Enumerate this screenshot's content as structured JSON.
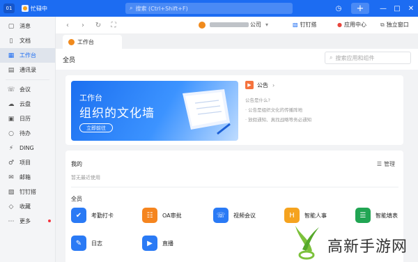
{
  "titlebar": {
    "user_id": "01",
    "status_text": "忙碌中",
    "search_placeholder": "搜索 (Ctrl+Shift+F)",
    "plus_label": "+"
  },
  "sidebar": {
    "items": [
      {
        "label": "消息",
        "icon": "message-icon"
      },
      {
        "label": "文档",
        "icon": "document-icon"
      },
      {
        "label": "工作台",
        "icon": "workbench-icon",
        "active": true
      },
      {
        "label": "通讯录",
        "icon": "contacts-icon"
      },
      {
        "label": "会议",
        "icon": "meeting-icon"
      },
      {
        "label": "云盘",
        "icon": "cloud-icon"
      },
      {
        "label": "日历",
        "icon": "calendar-icon"
      },
      {
        "label": "待办",
        "icon": "todo-icon"
      },
      {
        "label": "DING",
        "icon": "ding-icon"
      },
      {
        "label": "项目",
        "icon": "project-icon"
      },
      {
        "label": "邮箱",
        "icon": "mail-icon"
      },
      {
        "label": "钉钉搭",
        "icon": "dingda-icon"
      },
      {
        "label": "收藏",
        "icon": "favorite-icon"
      },
      {
        "label": "更多",
        "icon": "more-icon"
      }
    ]
  },
  "toolbar": {
    "org_suffix": "公司",
    "dingda_label": "钉钉搭",
    "app_center_label": "应用中心",
    "standalone_label": "独立窗口"
  },
  "tab": {
    "label": "工作台"
  },
  "main": {
    "title": "全员",
    "search_placeholder": "搜索应用和组件",
    "banner": {
      "line1": "工作台",
      "line2": "组织的文化墙",
      "button": "立即前往"
    },
    "notice": {
      "title": "公告",
      "lines": [
        "公告是什么?",
        "· 公告是组织文化的传播阵地",
        "· 放假通知、真找战略等务必通知"
      ]
    },
    "mine": {
      "title": "我的",
      "manage_label": "管理",
      "empty_text": "暂无最近使用"
    },
    "all": {
      "title": "全员",
      "apps": [
        {
          "label": "考勤打卡",
          "icon": "attendance-icon",
          "color": "#2a7af5"
        },
        {
          "label": "OA审批",
          "icon": "approval-icon",
          "color": "#f5851f"
        },
        {
          "label": "视频会议",
          "icon": "video-meeting-icon",
          "color": "#2a7af5"
        },
        {
          "label": "智能人事",
          "icon": "hr-icon",
          "color": "#f5a31f"
        },
        {
          "label": "智能填表",
          "icon": "form-icon",
          "color": "#21a553"
        },
        {
          "label": "日志",
          "icon": "log-icon",
          "color": "#2a7af5"
        },
        {
          "label": "直播",
          "icon": "live-icon",
          "color": "#2a7af5"
        }
      ]
    }
  },
  "watermark": {
    "text": "高新手游网"
  }
}
